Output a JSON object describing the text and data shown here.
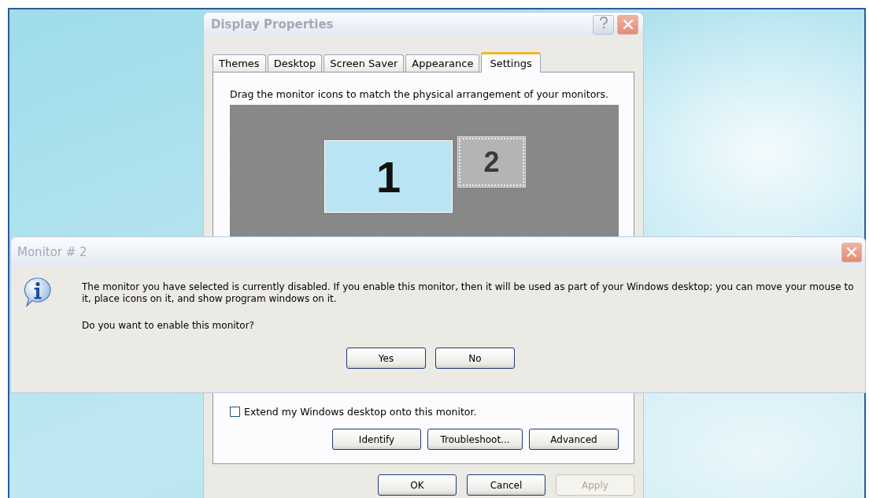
{
  "display_properties": {
    "title": "Display Properties",
    "tabs": [
      {
        "label": "Themes",
        "selected": false
      },
      {
        "label": "Desktop",
        "selected": false
      },
      {
        "label": "Screen Saver",
        "selected": false
      },
      {
        "label": "Appearance",
        "selected": false
      },
      {
        "label": "Settings",
        "selected": true
      }
    ],
    "instruction": "Drag the monitor icons to match the physical arrangement of your monitors.",
    "monitors": [
      {
        "label": "1",
        "selected": false,
        "enabled": true
      },
      {
        "label": "2",
        "selected": true,
        "enabled": false
      }
    ],
    "extend_checkbox": {
      "label": "Extend my Windows desktop onto this monitor.",
      "checked": false
    },
    "panel_buttons": [
      {
        "label": "Identify",
        "disabled": false
      },
      {
        "label": "Troubleshoot...",
        "disabled": false
      },
      {
        "label": "Advanced",
        "disabled": false
      }
    ],
    "buttons": [
      {
        "label": "OK",
        "disabled": false
      },
      {
        "label": "Cancel",
        "disabled": false
      },
      {
        "label": "Apply",
        "disabled": true
      }
    ]
  },
  "message_box": {
    "title": "Monitor # 2",
    "message": "The monitor you have selected is currently disabled. If you enable this monitor, then it will be used as part of your Windows desktop; you can move your mouse to it, place icons on it, and show program windows on it.",
    "question": "Do you want to enable this monitor?",
    "buttons": [
      {
        "label": "Yes",
        "disabled": false
      },
      {
        "label": "No",
        "disabled": false
      }
    ]
  }
}
